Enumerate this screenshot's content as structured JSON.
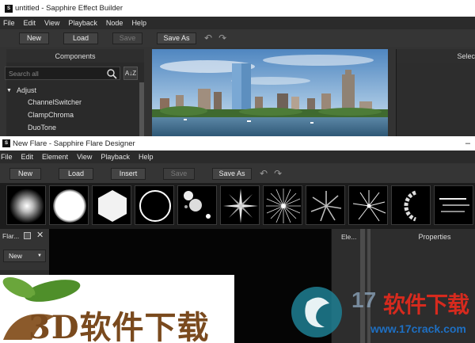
{
  "effect_builder": {
    "title": "untitled - Sapphire Effect Builder",
    "app_icon": "S",
    "menu": [
      "File",
      "Edit",
      "View",
      "Playback",
      "Node",
      "Help"
    ],
    "toolbar": {
      "new": "New",
      "load": "Load",
      "save": "Save",
      "save_as": "Save As"
    },
    "components": {
      "header": "Components",
      "search_placeholder": "Search all",
      "category": "Adjust",
      "items": [
        "ChannelSwitcher",
        "ClampChroma",
        "DuoTone"
      ]
    },
    "select_header": "Selec"
  },
  "flare_designer": {
    "title": "New Flare - Sapphire Flare Designer",
    "app_icon": "S",
    "window_control": "–",
    "menu": [
      "File",
      "Edit",
      "Element",
      "View",
      "Playback",
      "Help"
    ],
    "toolbar": {
      "new": "New",
      "load": "Load",
      "insert": "Insert",
      "save": "Save",
      "save_as": "Save As"
    },
    "flare_panel": {
      "header": "Flar...",
      "new_dropdown": "New"
    },
    "elements_header": "Ele...",
    "properties_header": "Properties",
    "thumbnails": [
      "glow",
      "disk",
      "hexagon",
      "ring",
      "bubbles",
      "star-4",
      "starburst",
      "radial-streaks",
      "spiky-star",
      "arc",
      "streaks"
    ]
  },
  "watermark": {
    "left_text": "3D软件下载",
    "right_number": "17",
    "right_text": "软件下载",
    "right_url": "www.17crack.com"
  },
  "colors": {
    "accent_green": "#4f8f2a",
    "watermark_blue": "#1e6fc2",
    "watermark_red": "#d62a1e"
  }
}
